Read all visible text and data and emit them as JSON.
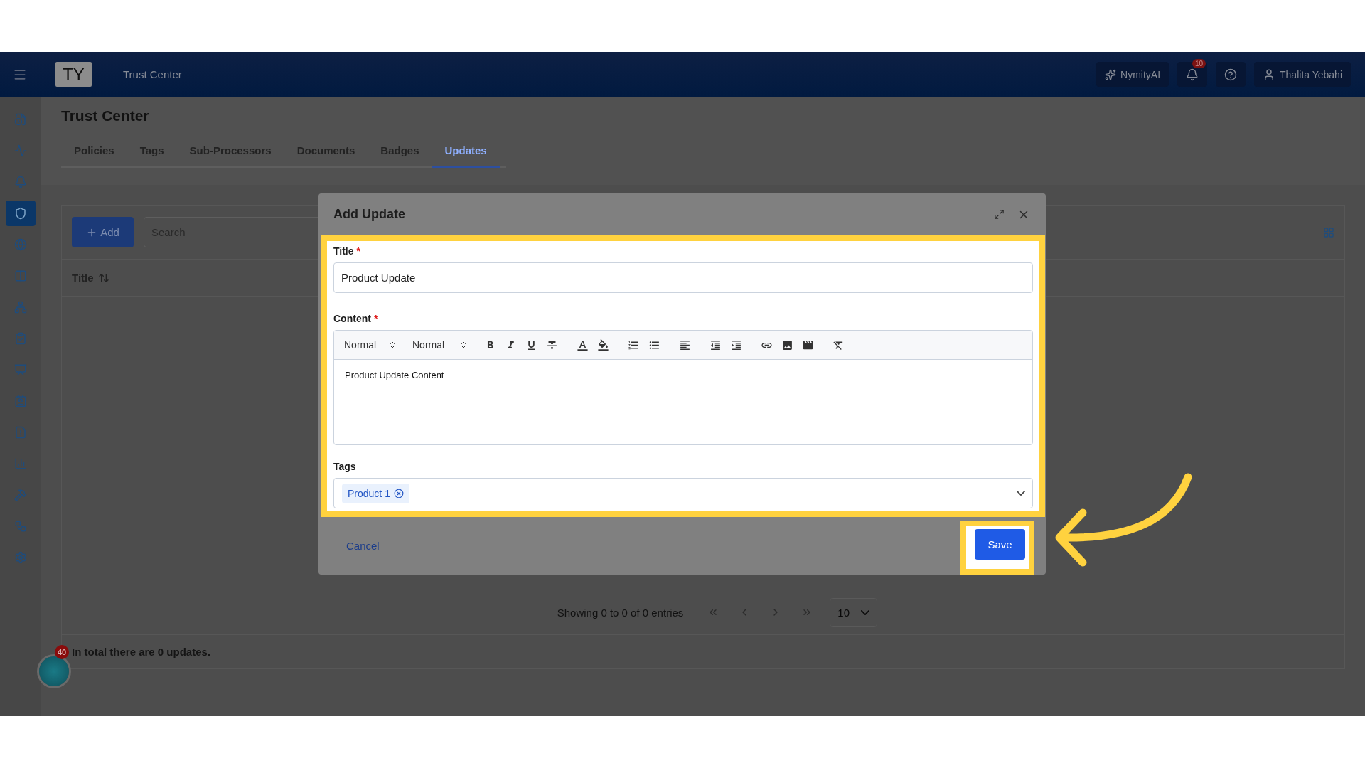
{
  "header": {
    "logo": "TY",
    "title": "Trust Center",
    "ai_button": "NymityAI",
    "notifications": "10",
    "user": "Thalita Yebahi"
  },
  "sidebar": {
    "items": [
      {
        "selected": false
      },
      {
        "selected": false
      },
      {
        "selected": false
      },
      {
        "selected": true
      },
      {
        "selected": false
      },
      {
        "selected": false
      },
      {
        "selected": false
      },
      {
        "selected": false
      },
      {
        "selected": false
      },
      {
        "selected": false
      },
      {
        "selected": false
      },
      {
        "selected": false
      },
      {
        "selected": false
      },
      {
        "selected": false
      },
      {
        "selected": false
      }
    ]
  },
  "page": {
    "title": "Trust Center",
    "tabs": [
      {
        "label": "Policies",
        "selected": false
      },
      {
        "label": "Tags",
        "selected": false
      },
      {
        "label": "Sub-Processors",
        "selected": false
      },
      {
        "label": "Documents",
        "selected": false
      },
      {
        "label": "Badges",
        "selected": false
      },
      {
        "label": "Updates",
        "selected": true
      }
    ],
    "add_button": "Add",
    "search": {
      "placeholder": "Search"
    },
    "table": {
      "columns": [
        "Title"
      ]
    },
    "pagination": {
      "summary": "Showing 0 to 0 of 0 entries",
      "page_size": "10"
    },
    "total": "In total there are 0 updates.",
    "chat_badge": "40"
  },
  "dialog": {
    "title": "Add Update",
    "fields": [
      {
        "kind": "text",
        "label": "Title",
        "required_mark": "*",
        "value": "Product Update"
      },
      {
        "kind": "editor",
        "label": "Content",
        "required_mark": "*",
        "selects": [
          "Normal",
          "Normal"
        ],
        "value": "Product Update Content"
      },
      {
        "kind": "tags",
        "label": "Tags",
        "tags": [
          "Product 1"
        ]
      }
    ],
    "cancel": "Cancel",
    "save": "Save"
  }
}
